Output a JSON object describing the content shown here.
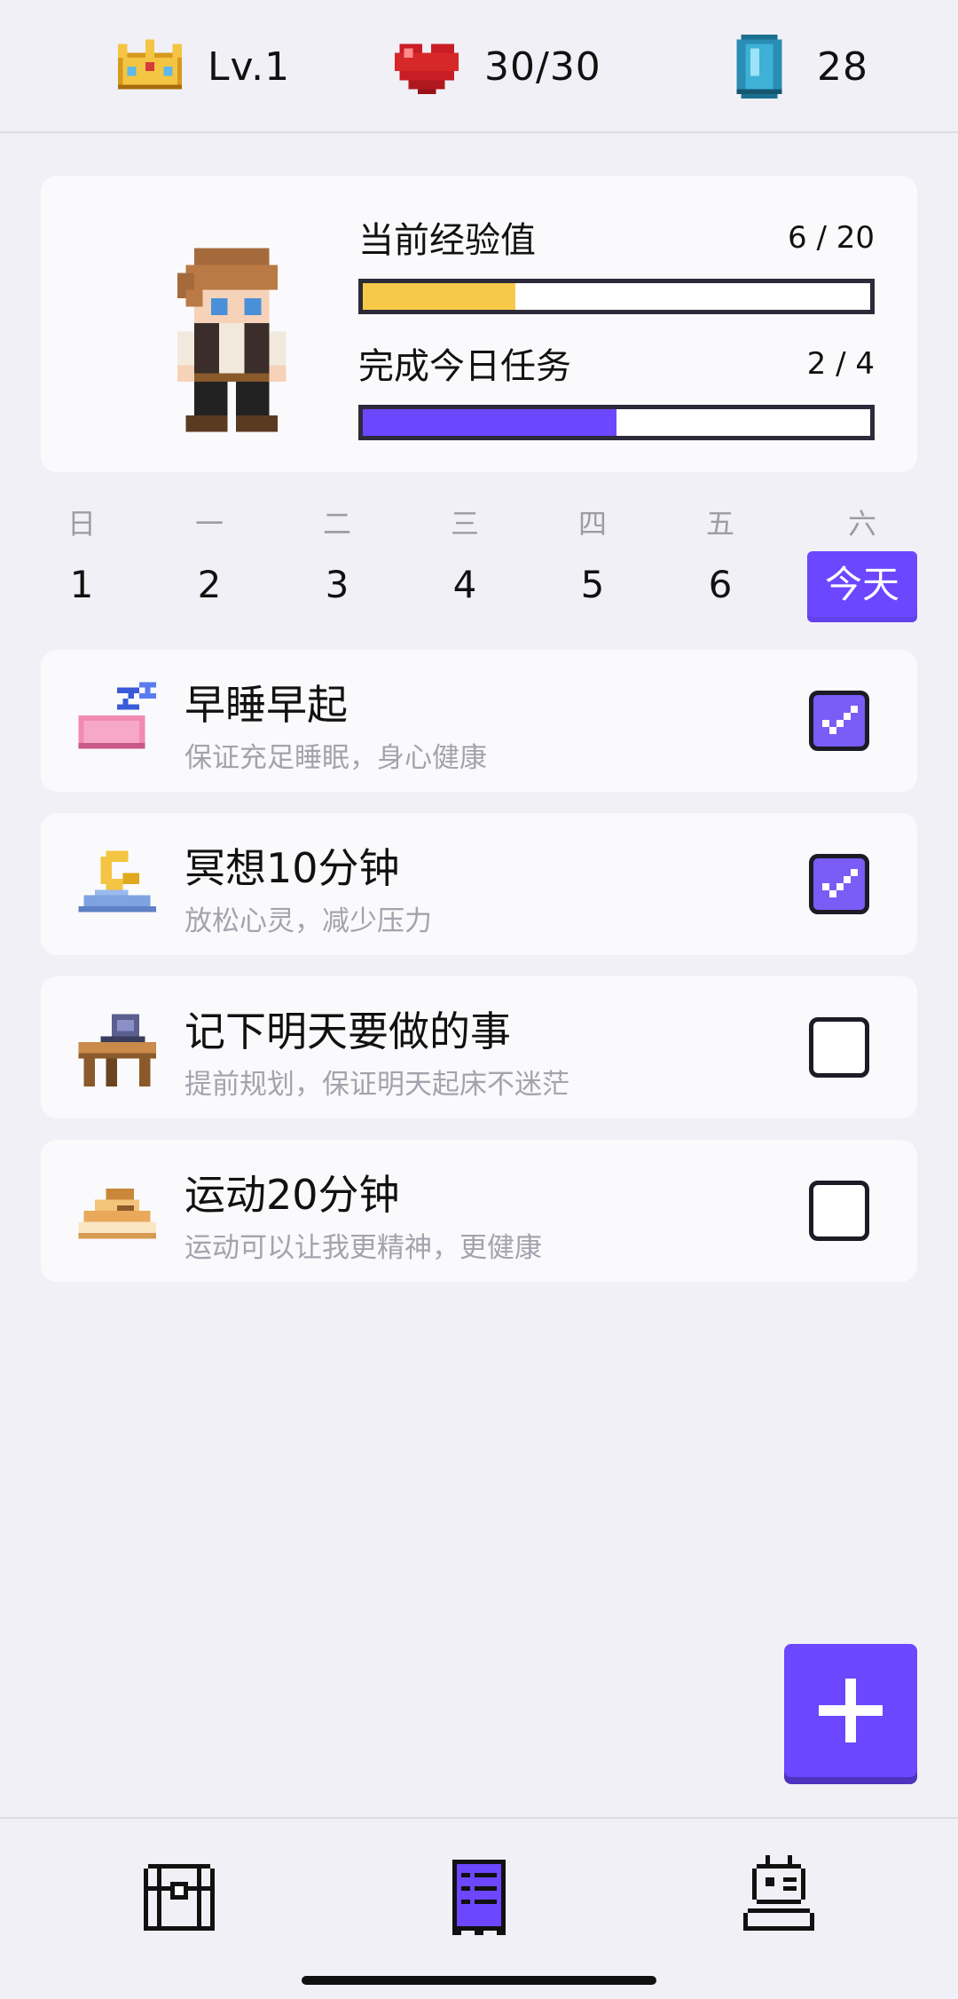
{
  "stats": {
    "level": "Lv.1",
    "hp": "30/30",
    "gems": "28"
  },
  "profile": {
    "exp_label": "当前经验值",
    "exp_value": "6 / 20",
    "exp_progress": 0.3,
    "tasks_label": "完成今日任务",
    "tasks_value": "2 / 4",
    "tasks_progress": 0.5
  },
  "week": [
    {
      "name": "日",
      "date": "1"
    },
    {
      "name": "一",
      "date": "2"
    },
    {
      "name": "二",
      "date": "3"
    },
    {
      "name": "三",
      "date": "4"
    },
    {
      "name": "四",
      "date": "5"
    },
    {
      "name": "五",
      "date": "6"
    },
    {
      "name": "六",
      "date": "今天"
    }
  ],
  "tasks": [
    {
      "title": "早睡早起",
      "desc": "保证充足睡眠，身心健康",
      "done": true,
      "icon": "sleep-pillow-icon"
    },
    {
      "title": "冥想10分钟",
      "desc": "放松心灵，减少压力",
      "done": true,
      "icon": "moon-cloud-icon"
    },
    {
      "title": "记下明天要做的事",
      "desc": "提前规划，保证明天起床不迷茫",
      "done": false,
      "icon": "desk-laptop-icon"
    },
    {
      "title": "运动20分钟",
      "desc": "运动可以让我更精神，更健康",
      "done": false,
      "icon": "sneaker-icon"
    }
  ],
  "colors": {
    "accent": "#6c47ff",
    "exp_bar": "#f7c948",
    "check_on": "#7a5cf6"
  },
  "nav": [
    "chest-icon",
    "task-list-icon",
    "character-icon"
  ]
}
